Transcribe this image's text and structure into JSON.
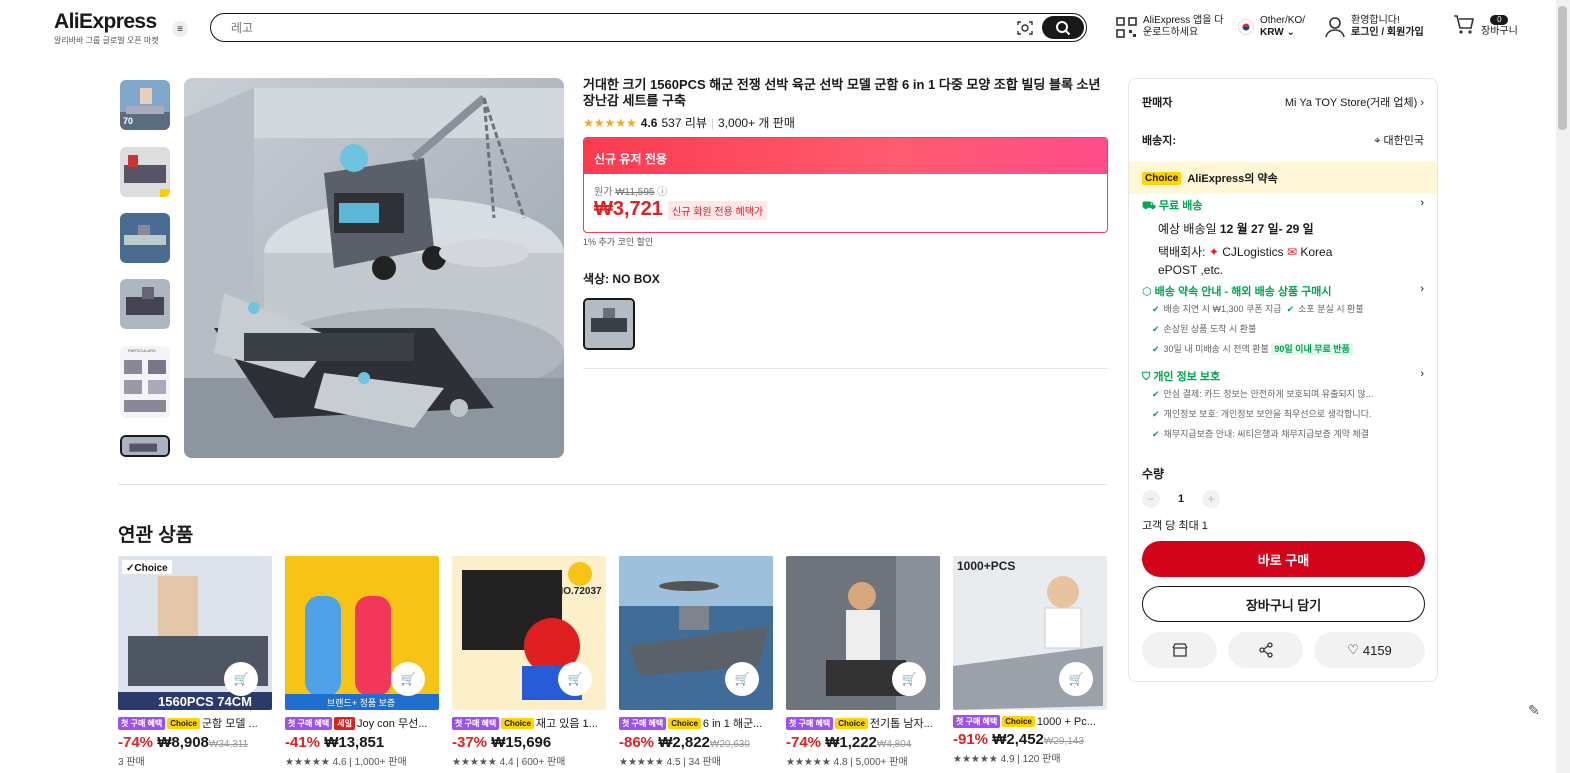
{
  "header": {
    "logo": "AliExpress",
    "logo_sub": "알리바바 그룹 글로벌 오픈 마켓",
    "search_placeholder": "레고",
    "app_line1": "AliExpress 앱을 다",
    "app_line2": "운로드하세요",
    "region_line1": "Other/KO/",
    "region_line2": "KRW",
    "account_line1": "환영합니다!",
    "account_line2": "로그인 / 회원가입",
    "cart_count": "0",
    "cart_label": "장바구니"
  },
  "product": {
    "title": "거대한 크기 1560PCS 해군 전쟁 선박 육군 선박 모델 군함 6 in 1 다중 모양 조합 빌딩 블록 소년 장난감 세트를 구축",
    "rating": "4.6",
    "reviews": "537 리뷰",
    "sold": "3,000+ 개 판매",
    "promo_header": "신규 유저 전용",
    "orig_label": "원가",
    "orig_price": "₩11,595",
    "price": "₩3,721",
    "price_badge": "신규 회원 전용 혜택가",
    "coin": "1% 추가 코인 할인",
    "color_label": "색상: NO BOX"
  },
  "panel": {
    "seller_label": "판매자",
    "seller_name": "Mi Ya TOY Store(거래 업체)",
    "ship_label": "배송지:",
    "ship_to": "대한민국",
    "choice_tag": "Choice",
    "choice_text": "AliExpress의 약속",
    "free_ship": "무료 배송",
    "eta_prefix": "예상 배송일",
    "eta": "12 월 27 일- 29 일",
    "courier_label": "택배회사:",
    "courier_1": "CJLogistics",
    "courier_2": "Korea",
    "courier_3": "ePOST ,etc.",
    "promise_title": "배송 약속 안내 - 해외 배송 상품 구매시",
    "promise_1": "배송 지연 시 ₩1,300 쿠폰 지급",
    "promise_2": "소포 분실 시 환불",
    "promise_3": "손상된 상품 도착 시 환불",
    "promise_4": "30일 내 미배송 시 전액 환불",
    "promise_4_badge": "90일 이내 무료 반품",
    "privacy_title": "개인 정보 보호",
    "privacy_1": "안심 결제: 카드 정보는 안전하게 보호되며 유출되지 않...",
    "privacy_2": "개인정보 보호: 개인정보 보안을 최우선으로 생각합니다.",
    "privacy_3": "채무지급보증 안내: 씨티은행과 채무지급보증 계약 체결",
    "qty_label": "수량",
    "qty_minus": "−",
    "qty_value": "1",
    "qty_plus": "+",
    "qty_limit": "고객 당 최대 1",
    "buy_now": "바로 구매",
    "add_cart": "장바구니 담기",
    "wish_count": "4159"
  },
  "related": {
    "heading": "연관 상품",
    "items": [
      {
        "tag1": "첫 구매 혜택",
        "tag2": "Choice",
        "title": "군함 모델 ...",
        "disc": "-74%",
        "price": "₩8,908",
        "old": "₩34,311",
        "sub": "3 판매",
        "img_text": "1560PCS 74CM"
      },
      {
        "tag1": "첫 구매 혜택",
        "tag2": "세일",
        "title": "Joy con 무선...",
        "disc": "-41%",
        "price": "₩13,851",
        "old": "",
        "sub": "★★★★★ 4.6 | 1,000+ 판매",
        "img_text": "브랜드+ 정품 보증"
      },
      {
        "tag1": "첫 구매 혜택",
        "tag2": "Choice",
        "title": "재고 있음 1...",
        "disc": "-37%",
        "price": "₩15,696",
        "old": "",
        "sub": "★★★★★ 4.4 | 600+ 판매",
        "img_text": "NO.72037"
      },
      {
        "tag1": "첫 구매 혜택",
        "tag2": "Choice",
        "title": "6 in 1 해군...",
        "disc": "-86%",
        "price": "₩2,822",
        "old": "₩20,630",
        "sub": "★★★★★ 4.5 | 34 판매",
        "img_text": ""
      },
      {
        "tag1": "첫 구매 혜택",
        "tag2": "Choice",
        "title": "전기톱 남자...",
        "disc": "-74%",
        "price": "₩1,222",
        "old": "₩4,804",
        "sub": "★★★★★ 4.8 | 5,000+ 판매",
        "img_text": ""
      },
      {
        "tag1": "첫 구매 혜택",
        "tag2": "Choice",
        "title": "1000 + Pc...",
        "disc": "-91%",
        "price": "₩2,452",
        "old": "₩29,143",
        "sub": "★★★★★ 4.9 | 120 판매",
        "img_text": "1000+PCS"
      }
    ]
  },
  "colors": {
    "accent": "#d3031c",
    "promo": "#fd384f",
    "choice": "#ffd400",
    "green": "#00a651"
  }
}
